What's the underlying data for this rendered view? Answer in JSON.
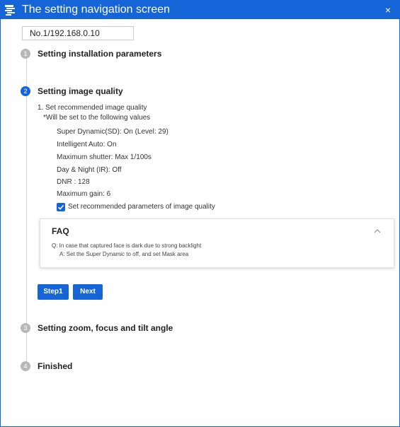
{
  "window": {
    "title": "The setting navigation screen",
    "close_glyph": "×",
    "accent_color": "#1565d8"
  },
  "address": "No.1/192.168.0.10",
  "steps": [
    {
      "number": "1",
      "title": "Setting installation parameters",
      "state": "inactive"
    },
    {
      "number": "2",
      "title": "Setting image quality",
      "state": "active"
    },
    {
      "number": "3",
      "title": "Setting zoom, focus and tilt angle",
      "state": "inactive"
    },
    {
      "number": "4",
      "title": "Finished",
      "state": "inactive"
    }
  ],
  "image_quality": {
    "heading": "1. Set recommended image quality",
    "note": "*Will be set to the following values",
    "values": [
      "Super Dynamic(SD): On (Level: 29)",
      "Intelligent Auto: On",
      "Maximum shutter: Max 1/100s",
      "Day & Night (IR): Off",
      "DNR : 128",
      "Maximum gain: 6"
    ],
    "checkbox_label": "Set recommended parameters of image quality",
    "checkbox_checked": true
  },
  "faq": {
    "title": "FAQ",
    "question": "Q: In case that captured face is dark due to strong backlight",
    "answer": "A: Set the Super Dynamic to off, and set Mask area",
    "expanded": true
  },
  "buttons": {
    "step1": "Step1",
    "next": "Next"
  }
}
